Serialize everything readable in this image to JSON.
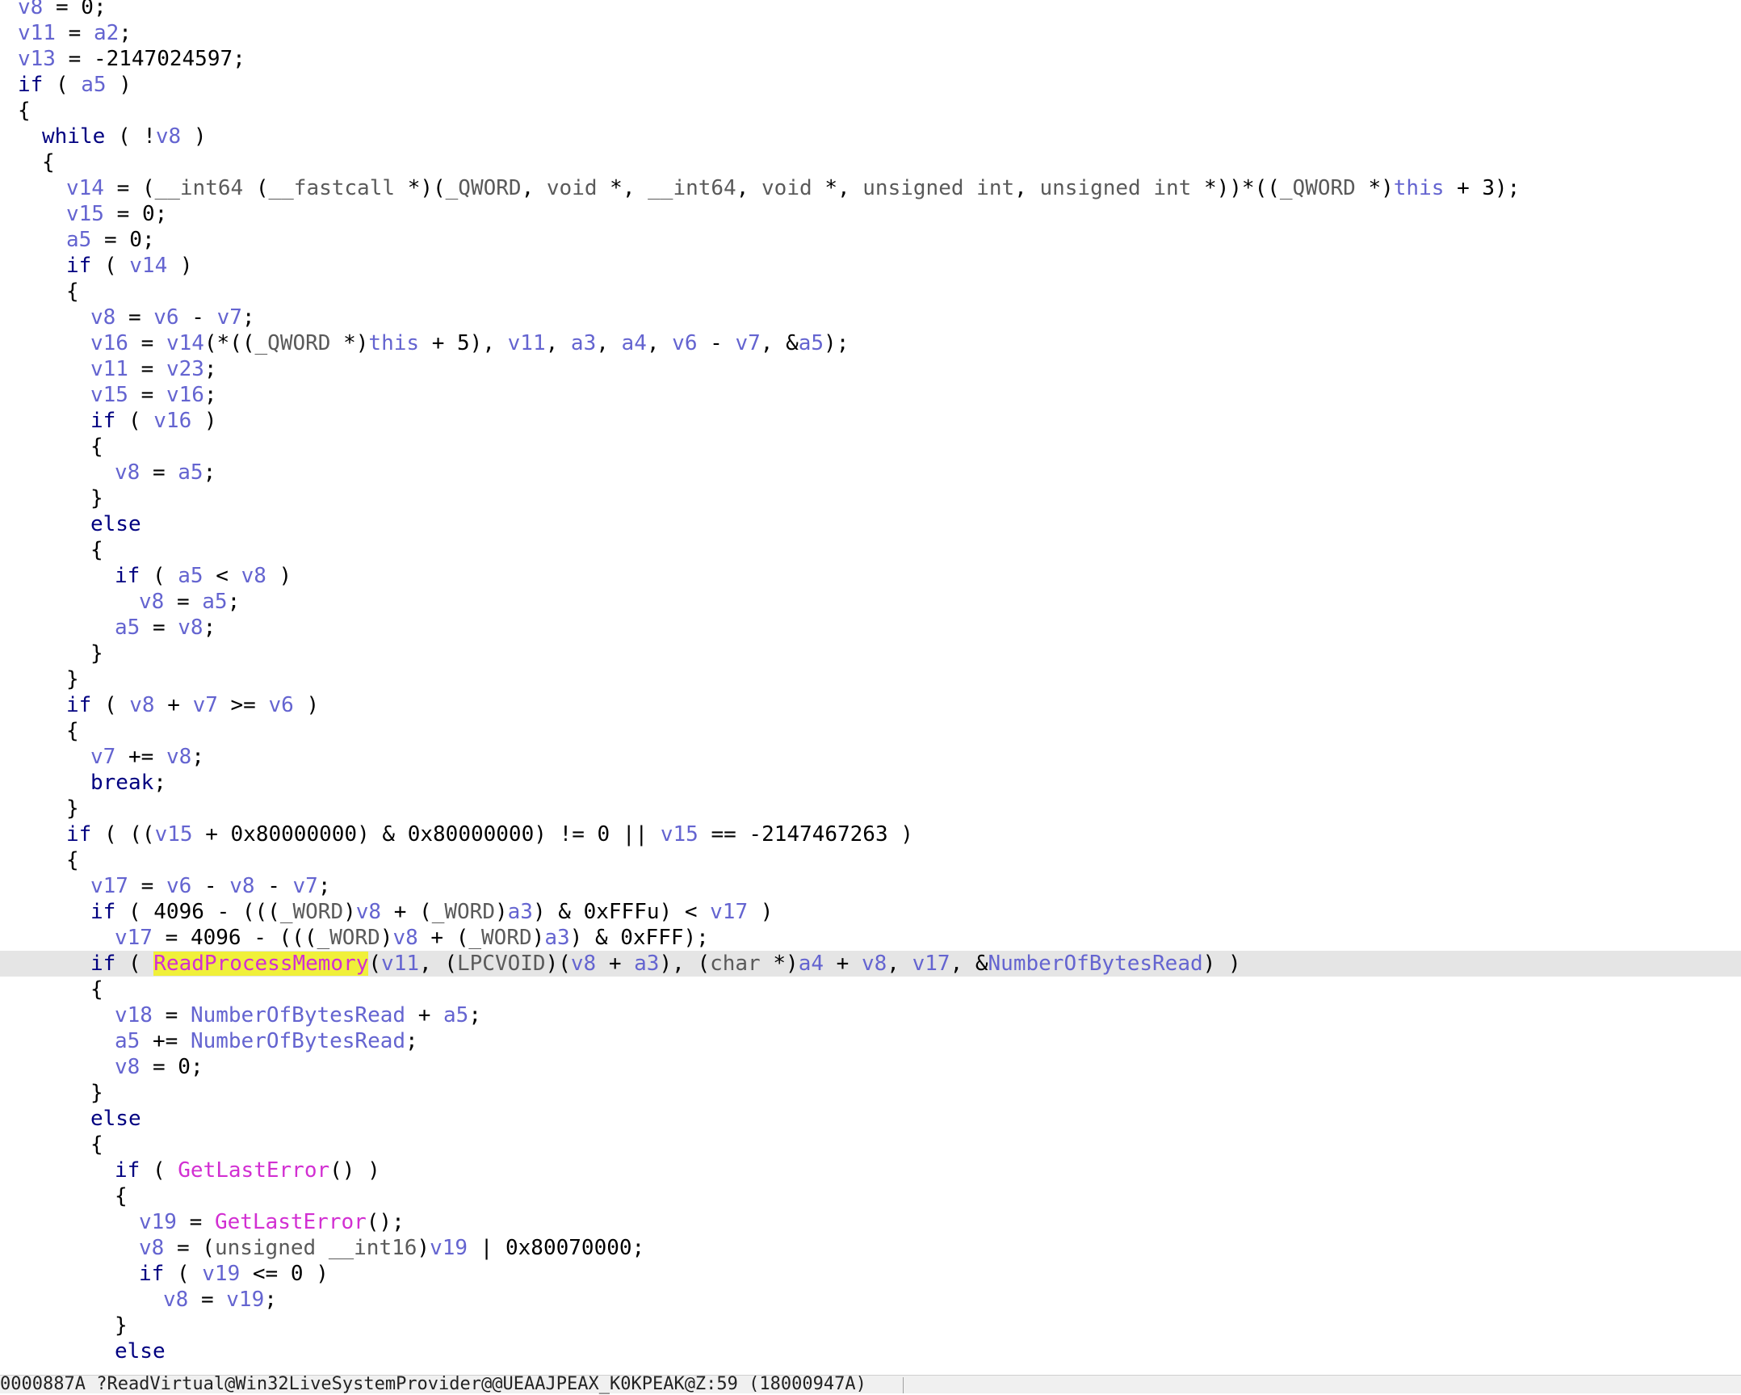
{
  "editor": {
    "highlighted_line": 37,
    "lines": [
      {
        "indent": 0,
        "text": "v8 = 0;"
      },
      {
        "indent": 0,
        "text": "v11 = a2;"
      },
      {
        "indent": 0,
        "text": "v13 = -2147024597;"
      },
      {
        "indent": 0,
        "text": "if ( a5 )"
      },
      {
        "indent": 0,
        "text": "{"
      },
      {
        "indent": 1,
        "text": "while ( !v8 )"
      },
      {
        "indent": 1,
        "text": "{"
      },
      {
        "indent": 2,
        "text": "v14 = (__int64 (__fastcall *)(_QWORD, void *, __int64, void *, unsigned int, unsigned int *))*((_QWORD *)this + 3);"
      },
      {
        "indent": 2,
        "text": "v15 = 0;"
      },
      {
        "indent": 2,
        "text": "a5 = 0;"
      },
      {
        "indent": 2,
        "text": "if ( v14 )"
      },
      {
        "indent": 2,
        "text": "{"
      },
      {
        "indent": 3,
        "text": "v8 = v6 - v7;"
      },
      {
        "indent": 3,
        "text": "v16 = v14(*((_QWORD *)this + 5), v11, a3, a4, v6 - v7, &a5);"
      },
      {
        "indent": 3,
        "text": "v11 = v23;"
      },
      {
        "indent": 3,
        "text": "v15 = v16;"
      },
      {
        "indent": 3,
        "text": "if ( v16 )"
      },
      {
        "indent": 3,
        "text": "{"
      },
      {
        "indent": 4,
        "text": "v8 = a5;"
      },
      {
        "indent": 3,
        "text": "}"
      },
      {
        "indent": 3,
        "text": "else"
      },
      {
        "indent": 3,
        "text": "{"
      },
      {
        "indent": 4,
        "text": "if ( a5 < v8 )"
      },
      {
        "indent": 5,
        "text": "v8 = a5;"
      },
      {
        "indent": 4,
        "text": "a5 = v8;"
      },
      {
        "indent": 3,
        "text": "}"
      },
      {
        "indent": 2,
        "text": "}"
      },
      {
        "indent": 2,
        "text": "if ( v8 + v7 >= v6 )"
      },
      {
        "indent": 2,
        "text": "{"
      },
      {
        "indent": 3,
        "text": "v7 += v8;"
      },
      {
        "indent": 3,
        "text": "break;"
      },
      {
        "indent": 2,
        "text": "}"
      },
      {
        "indent": 2,
        "text": "if ( ((v15 + 0x80000000) & 0x80000000) != 0 || v15 == -2147467263 )"
      },
      {
        "indent": 2,
        "text": "{"
      },
      {
        "indent": 3,
        "text": "v17 = v6 - v8 - v7;"
      },
      {
        "indent": 3,
        "text": "if ( 4096 - (((_WORD)v8 + (_WORD)a3) & 0xFFFu) < v17 )"
      },
      {
        "indent": 4,
        "text": "v17 = 4096 - (((_WORD)v8 + (_WORD)a3) & 0xFFF);"
      },
      {
        "indent": 3,
        "text": "if ( ReadProcessMemory(v11, (LPCVOID)(v8 + a3), (char *)a4 + v8, v17, &NumberOfBytesRead) )"
      },
      {
        "indent": 3,
        "text": "{"
      },
      {
        "indent": 4,
        "text": "v18 = NumberOfBytesRead + a5;"
      },
      {
        "indent": 4,
        "text": "a5 += NumberOfBytesRead;"
      },
      {
        "indent": 4,
        "text": "v8 = 0;"
      },
      {
        "indent": 3,
        "text": "}"
      },
      {
        "indent": 3,
        "text": "else"
      },
      {
        "indent": 3,
        "text": "{"
      },
      {
        "indent": 4,
        "text": "if ( GetLastError() )"
      },
      {
        "indent": 4,
        "text": "{"
      },
      {
        "indent": 5,
        "text": "v19 = GetLastError();"
      },
      {
        "indent": 5,
        "text": "v8 = (unsigned __int16)v19 | 0x80070000;"
      },
      {
        "indent": 5,
        "text": "if ( v19 <= 0 )"
      },
      {
        "indent": 6,
        "text": "v8 = v19;"
      },
      {
        "indent": 4,
        "text": "}"
      },
      {
        "indent": 4,
        "text": "else"
      }
    ]
  },
  "status_bar": {
    "location": "0000887A ?ReadVirtual@Win32LiveSystemProvider@@UEAAJPEAX_K0KPEAK@Z:59 (18000947A)"
  },
  "colors": {
    "variable": "#6464d0",
    "keyword": "#000000",
    "api_function": "#d22fd2",
    "search_highlight": "#f0f03a",
    "current_line": "#e5e5e5"
  }
}
